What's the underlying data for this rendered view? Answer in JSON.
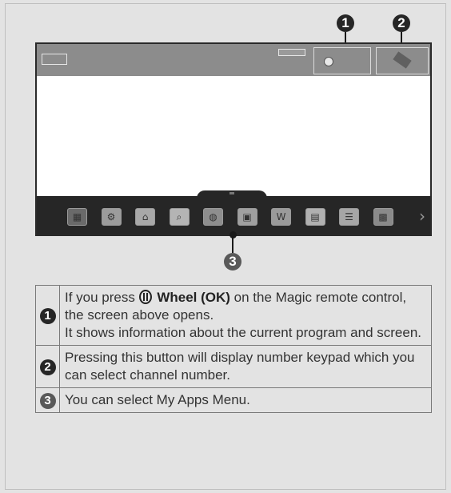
{
  "callouts": {
    "one": "1",
    "two": "2",
    "three": "3"
  },
  "screen": {
    "topbar_color": "#8c8c8c",
    "apps_bar_color": "#262626",
    "apps": [
      {
        "icon": "channel-list-icon",
        "glyph": "▦",
        "color": "#6a6a6a"
      },
      {
        "icon": "settings-icon",
        "glyph": "⚙",
        "color": "#9c9c9c"
      },
      {
        "icon": "home-icon",
        "glyph": "⌂",
        "color": "#a8a8a8"
      },
      {
        "icon": "search-icon",
        "glyph": "⌕",
        "color": "#b4b4b4"
      },
      {
        "icon": "globe-icon",
        "glyph": "◍",
        "color": "#8e8e8e"
      },
      {
        "icon": "media-icon",
        "glyph": "▣",
        "color": "#a0a0a0"
      },
      {
        "icon": "w-app-icon",
        "glyph": "W",
        "color": "#9a9a9a"
      },
      {
        "icon": "picture-icon",
        "glyph": "▤",
        "color": "#b0b0b0"
      },
      {
        "icon": "document-icon",
        "glyph": "☰",
        "color": "#a6a6a6"
      },
      {
        "icon": "photo-icon",
        "glyph": "▩",
        "color": "#8a8a8a"
      }
    ],
    "more": "›"
  },
  "table": {
    "rows": [
      {
        "num": "1",
        "text_pre": "If you press ",
        "text_bold": "Wheel (OK)",
        "text_post": " on the Magic remote control, the screen above opens.",
        "text_line2": "It shows information about the current program and screen."
      },
      {
        "num": "2",
        "text": "Pressing this button will display number keypad which you can select channel number."
      },
      {
        "num": "3",
        "text": "You can select My Apps Menu."
      }
    ]
  }
}
